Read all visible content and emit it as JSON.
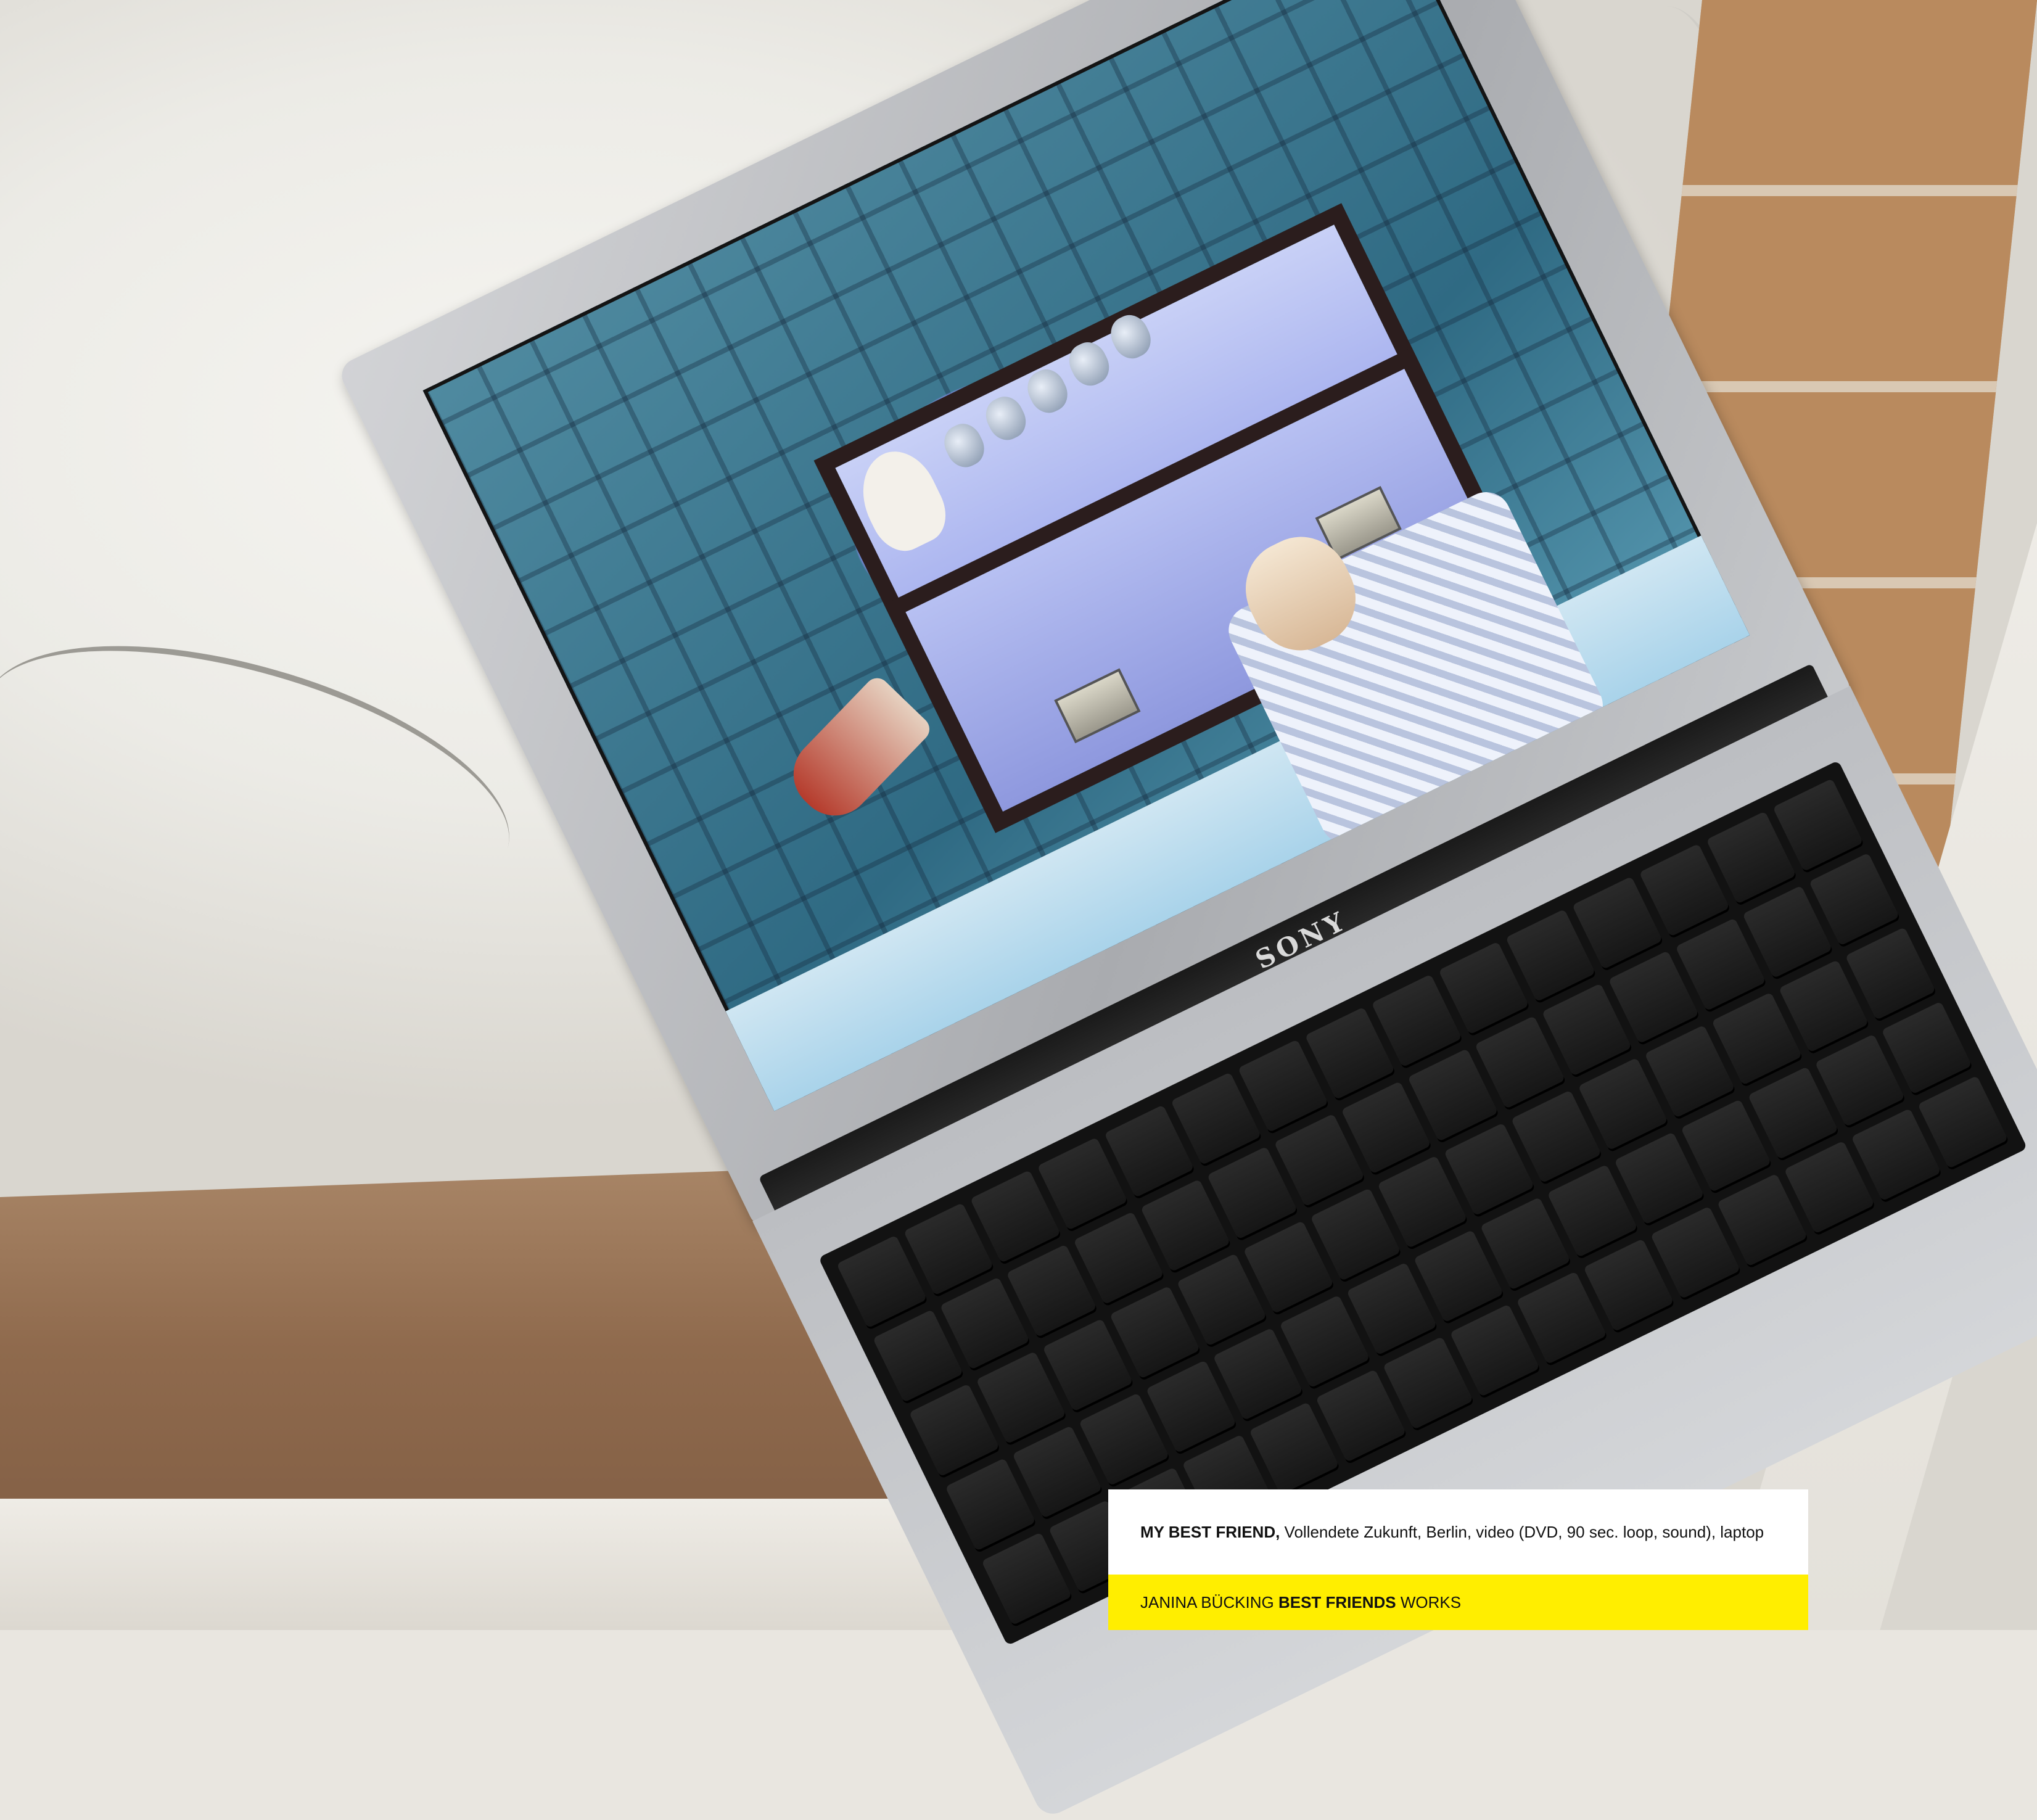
{
  "caption": {
    "work_title": "MY BEST FRIEND,",
    "work_details": " Vollendete Zukunft, Berlin, video (DVD, 90 sec. loop, sound), laptop",
    "artist": "JANINA BÜCKING",
    "series_bold": "BEST FRIENDS",
    "series_tail": "WORKS"
  },
  "laptop": {
    "brand": "SONY"
  },
  "colors": {
    "caption_bar": "#ffee00",
    "caption_panel": "#ffffff",
    "screen_tint": "#2f6a83"
  }
}
